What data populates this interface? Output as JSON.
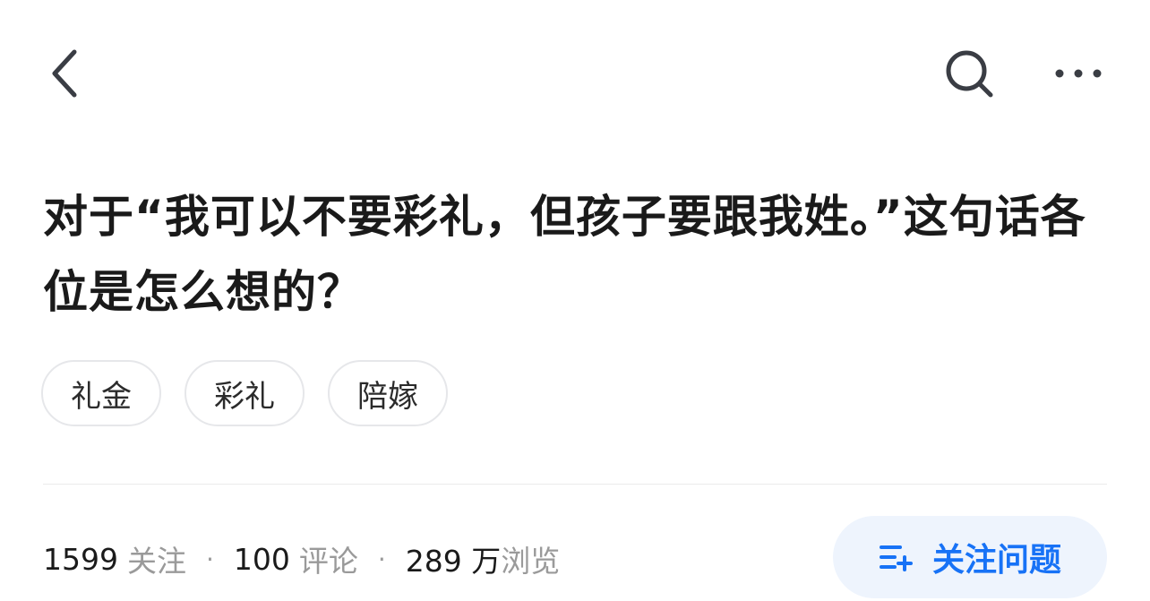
{
  "nav": {
    "back_icon": "chevron-left-icon",
    "search_icon": "search-icon",
    "more_icon": "more-horizontal-icon"
  },
  "question": {
    "title": "对于“我可以不要彩礼，但孩子要跟我姓。”这句话各位是怎么想的？"
  },
  "tags": [
    {
      "label": "礼金"
    },
    {
      "label": "彩礼"
    },
    {
      "label": "陪嫁"
    }
  ],
  "stats": {
    "followers_count": "1599",
    "followers_label": "关注",
    "comments_count": "100",
    "comments_label": "评论",
    "views_count": "289 万",
    "views_label": "浏览",
    "separator": "·"
  },
  "follow_button": {
    "label": "关注问题",
    "icon": "list-add-icon"
  },
  "colors": {
    "accent": "#1772f6",
    "accent_bg": "#eef4fd",
    "text": "#1a1a1a",
    "muted": "#9a9a9a",
    "tag_border": "#e6e7ea"
  }
}
